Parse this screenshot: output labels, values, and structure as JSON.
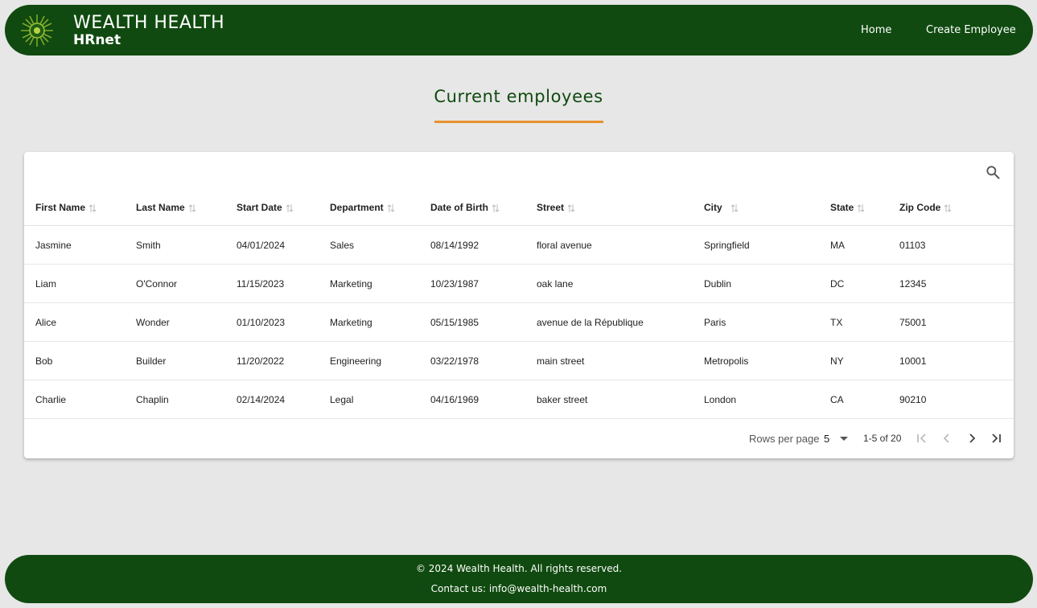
{
  "header": {
    "brand_title": "WEALTH HEALTH",
    "brand_subtitle": "HRnet",
    "nav": {
      "home": "Home",
      "create": "Create Employee"
    },
    "colors": {
      "background": "#104a10",
      "accent": "#e8922e"
    }
  },
  "page": {
    "title": "Current employees"
  },
  "table": {
    "columns": [
      "First Name",
      "Last Name",
      "Start Date",
      "Department",
      "Date of Birth",
      "Street",
      "City",
      "State",
      "Zip Code"
    ],
    "rows": [
      [
        "Jasmine",
        "Smith",
        "04/01/2024",
        "Sales",
        "08/14/1992",
        "floral avenue",
        "Springfield",
        "MA",
        "01103"
      ],
      [
        "Liam",
        "O'Connor",
        "11/15/2023",
        "Marketing",
        "10/23/1987",
        "oak lane",
        "Dublin",
        "DC",
        "12345"
      ],
      [
        "Alice",
        "Wonder",
        "01/10/2023",
        "Marketing",
        "05/15/1985",
        "avenue de la République",
        "Paris",
        "TX",
        "75001"
      ],
      [
        "Bob",
        "Builder",
        "11/20/2022",
        "Engineering",
        "03/22/1978",
        "main street",
        "Metropolis",
        "NY",
        "10001"
      ],
      [
        "Charlie",
        "Chaplin",
        "02/14/2024",
        "Legal",
        "04/16/1969",
        "baker street",
        "London",
        "CA",
        "90210"
      ]
    ]
  },
  "pagination": {
    "rows_per_page_label": "Rows per page",
    "rows_per_page": "5",
    "range": "1-5 of 20"
  },
  "icons": {
    "search": "search-icon",
    "sort": "sort-icon",
    "first": "first-page-icon",
    "prev": "chevron-left-icon",
    "next": "chevron-right-icon",
    "last": "last-page-icon",
    "dropdown": "caret-down-icon",
    "logo": "sun-logo-icon"
  },
  "footer": {
    "copyright": "© 2024 Wealth Health. All rights reserved.",
    "contact": "Contact us: info@wealth-health.com"
  }
}
